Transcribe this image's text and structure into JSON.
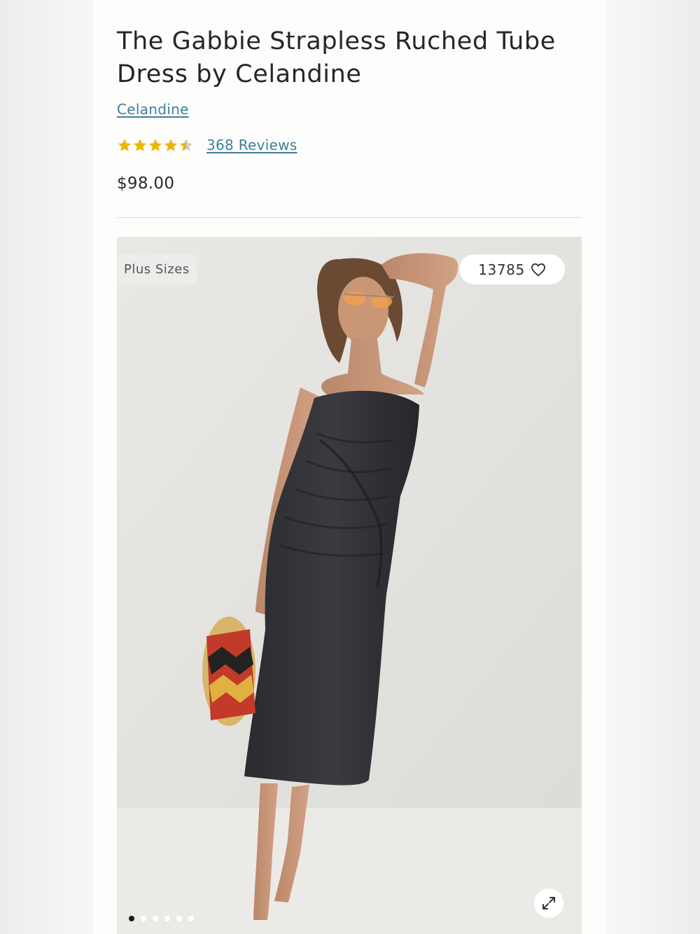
{
  "product": {
    "title": "The Gabbie Strapless Ruched Tube Dress by Celandine",
    "brand": "Celandine",
    "rating": 4.5,
    "rating_max": 5,
    "reviews_label": "368 Reviews",
    "price": "$98.00"
  },
  "gallery": {
    "badge": "Plus Sizes",
    "favorites_count": "13785",
    "heart_icon": "heart-outline-icon",
    "expand_icon": "expand-arrows-icon",
    "image_count": 6,
    "active_index": 0
  },
  "colors": {
    "link": "#3e7f9a",
    "star": "#f0b400",
    "star_empty": "#cfcfcf"
  }
}
